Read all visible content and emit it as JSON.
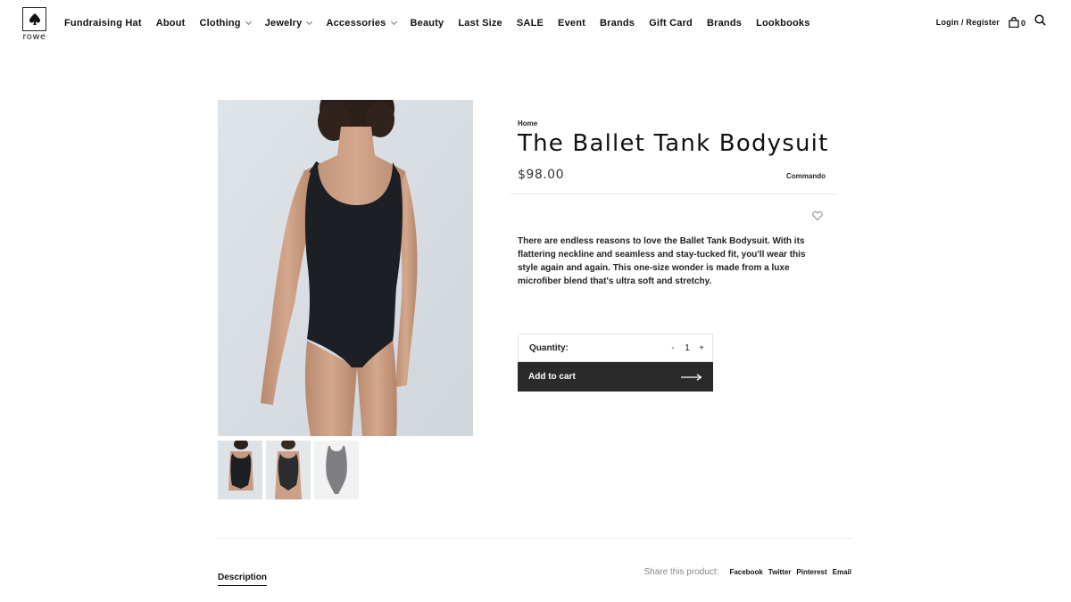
{
  "brand": {
    "name": "rowe"
  },
  "nav": {
    "items": [
      {
        "label": "Fundraising Hat",
        "dropdown": false
      },
      {
        "label": "About",
        "dropdown": false
      },
      {
        "label": "Clothing",
        "dropdown": true
      },
      {
        "label": "Jewelry",
        "dropdown": true
      },
      {
        "label": "Accessories",
        "dropdown": true
      },
      {
        "label": "Beauty",
        "dropdown": false
      },
      {
        "label": "Last Size",
        "dropdown": false
      },
      {
        "label": "SALE",
        "dropdown": false
      },
      {
        "label": "Event",
        "dropdown": false
      },
      {
        "label": "Brands",
        "dropdown": false
      },
      {
        "label": "Gift Card",
        "dropdown": false
      },
      {
        "label": "Brands",
        "dropdown": false
      },
      {
        "label": "Lookbooks",
        "dropdown": false
      }
    ]
  },
  "header": {
    "login_label": "Login / Register",
    "cart_count": "0",
    "icons": [
      "bag-icon",
      "search-icon"
    ]
  },
  "product": {
    "breadcrumb": "Home",
    "title": "The Ballet Tank Bodysuit",
    "price": "$98.00",
    "vendor": "Commando",
    "description": "There are endless reasons to love the Ballet Tank Bodysuit. With its flattering neckline and seamless and stay-tucked fit, you'll wear this style again and again. This one-size wonder is made from a luxe microfiber blend that's ultra soft and stretchy.",
    "quantity_label": "Quantity:",
    "quantity_value": "1",
    "qty_minus": "-",
    "qty_plus": "+",
    "add_to_cart_label": "Add to cart"
  },
  "bottom": {
    "tab_label": "Description",
    "share_label": "Share this product:",
    "share_links": [
      "Facebook",
      "Twitter",
      "Pinterest",
      "Email"
    ]
  },
  "colors": {
    "button_bg": "#2a2a2a",
    "image_bg": "#d8dee3",
    "bodysuit": "#1c1f24"
  }
}
